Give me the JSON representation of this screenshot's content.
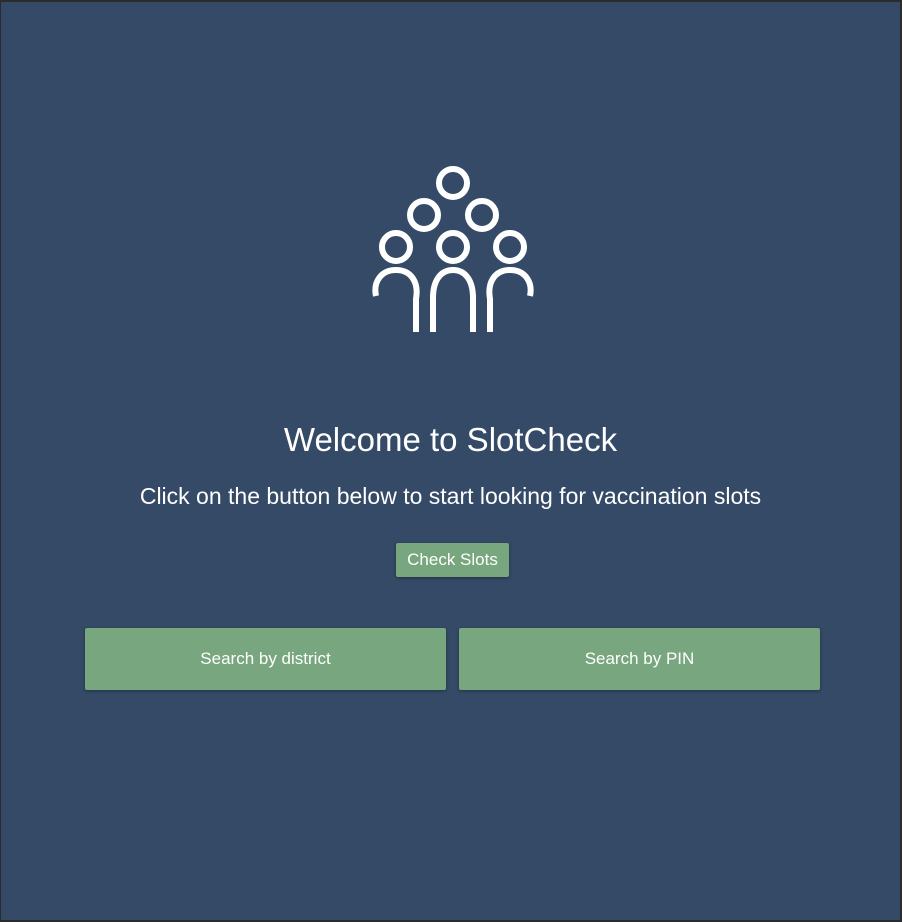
{
  "main": {
    "logo_icon": "people-group-icon",
    "title": "Welcome to SlotCheck",
    "subtitle": "Click on the button below to start looking for vaccination slots",
    "check_slots_label": "Check Slots",
    "search_district_label": "Search by district",
    "search_pin_label": "Search by PIN"
  },
  "colors": {
    "background": "#344a66",
    "button": "#78a67e",
    "text": "#ffffff"
  }
}
